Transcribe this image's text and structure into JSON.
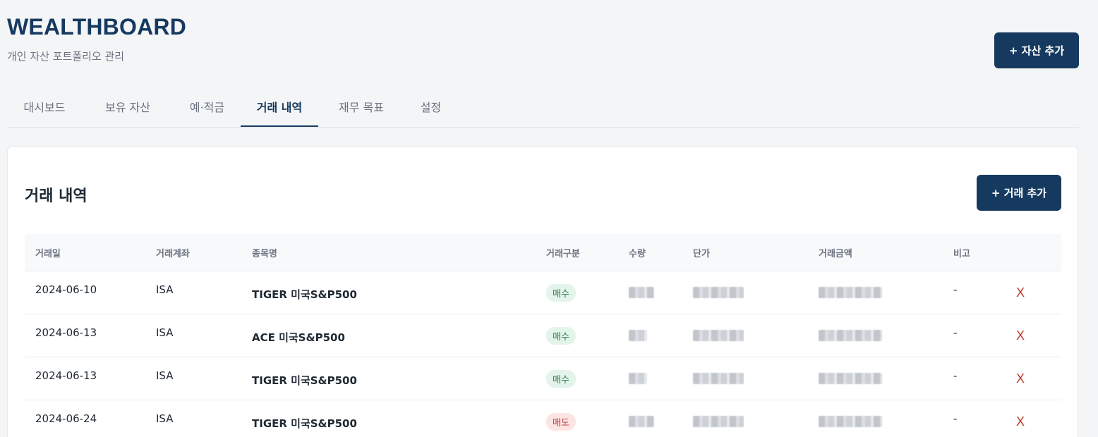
{
  "header": {
    "brand": "WEALTHBOARD",
    "subtitle": "개인 자산 포트폴리오 관리",
    "add_asset_label": "+ 자산 추가"
  },
  "tabs": [
    {
      "label": "대시보드",
      "active": false
    },
    {
      "label": "보유 자산",
      "active": false
    },
    {
      "label": "예·적금",
      "active": false
    },
    {
      "label": "거래 내역",
      "active": true
    },
    {
      "label": "재무 목표",
      "active": false
    },
    {
      "label": "설정",
      "active": false
    }
  ],
  "panel": {
    "title": "거래 내역",
    "add_trade_label": "+ 거래 추가"
  },
  "table": {
    "columns": [
      "거래일",
      "거래계좌",
      "종목명",
      "거래구분",
      "수량",
      "단가",
      "거래금액",
      "비고"
    ],
    "rows": [
      {
        "date": "2024-06-10",
        "account": "ISA",
        "name": "TIGER 미국S&P500",
        "type": "매수",
        "type_kind": "buy",
        "note": "-",
        "delete": "X"
      },
      {
        "date": "2024-06-13",
        "account": "ISA",
        "name": "ACE 미국S&P500",
        "type": "매수",
        "type_kind": "buy",
        "note": "-",
        "delete": "X"
      },
      {
        "date": "2024-06-13",
        "account": "ISA",
        "name": "TIGER 미국S&P500",
        "type": "매수",
        "type_kind": "buy",
        "note": "-",
        "delete": "X"
      },
      {
        "date": "2024-06-24",
        "account": "ISA",
        "name": "TIGER 미국S&P500",
        "type": "매도",
        "type_kind": "sell",
        "note": "-",
        "delete": "X"
      }
    ]
  },
  "colors": {
    "brand": "#163a5f",
    "buy_badge_bg": "#e3f4ea",
    "buy_badge_text": "#2f7a4d",
    "sell_badge_bg": "#fde4e4",
    "sell_badge_text": "#b43c3c",
    "delete": "#c0392b"
  }
}
